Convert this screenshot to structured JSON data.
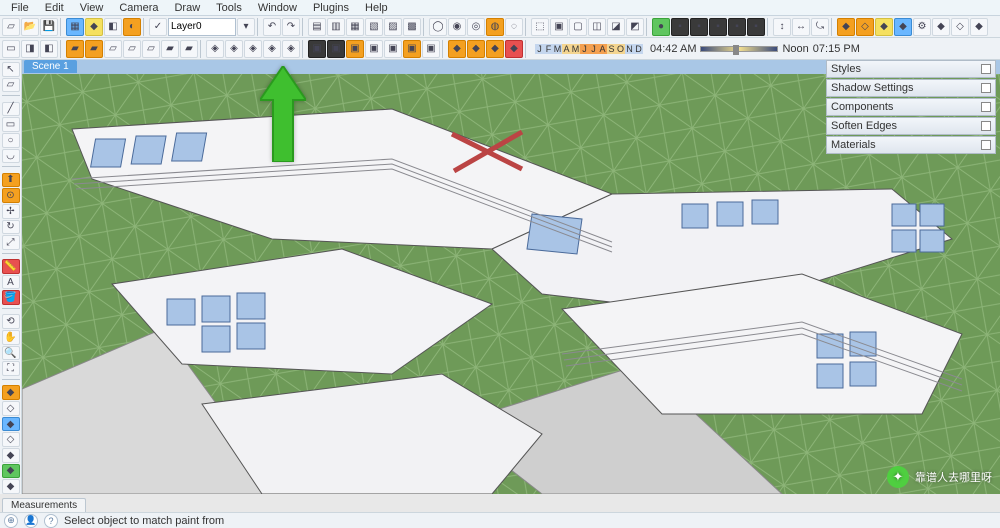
{
  "menubar": [
    "File",
    "Edit",
    "View",
    "Camera",
    "Draw",
    "Tools",
    "Window",
    "Plugins",
    "Help"
  ],
  "layer": {
    "value": "Layer0"
  },
  "months": [
    {
      "l": "J",
      "c": "cold"
    },
    {
      "l": "F",
      "c": "cold"
    },
    {
      "l": "M",
      "c": "cold"
    },
    {
      "l": "A",
      "c": "warm"
    },
    {
      "l": "M",
      "c": "warm"
    },
    {
      "l": "J",
      "c": "hot"
    },
    {
      "l": "J",
      "c": "hot"
    },
    {
      "l": "A",
      "c": "hot"
    },
    {
      "l": "S",
      "c": "warm"
    },
    {
      "l": "O",
      "c": "warm"
    },
    {
      "l": "N",
      "c": "cold"
    },
    {
      "l": "D",
      "c": "cold"
    }
  ],
  "time": {
    "left": "04:42 AM",
    "mid": "Noon",
    "right": "07:15 PM"
  },
  "scene_tab": "Scene 1",
  "panels": [
    "Styles",
    "Shadow Settings",
    "Components",
    "Soften Edges",
    "Materials"
  ],
  "bottom_tab": "Measurements",
  "status": {
    "hint": "Select object to match paint from"
  },
  "watermark": {
    "text": "靠谱人去哪里呀"
  }
}
